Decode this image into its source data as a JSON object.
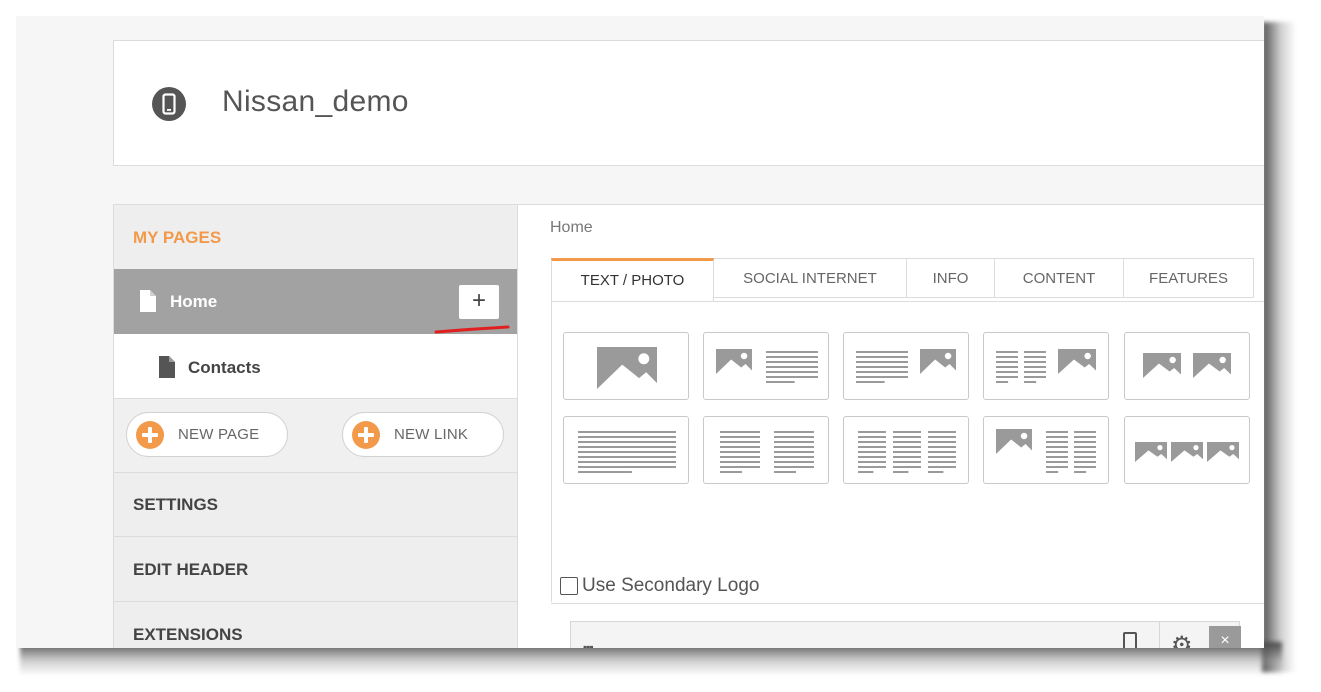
{
  "app": {
    "title": "Nissan_demo",
    "icon": "phone-icon"
  },
  "sidebar": {
    "my_pages_label": "MY PAGES",
    "pages": [
      {
        "label": "Home",
        "selected": true,
        "add_label": "+"
      },
      {
        "label": "Contacts",
        "selected": false
      }
    ],
    "new_page_label": "NEW PAGE",
    "new_link_label": "NEW LINK",
    "settings_label": "SETTINGS",
    "edit_header_label": "EDIT HEADER",
    "extensions_label": "EXTENSIONS"
  },
  "main": {
    "breadcrumb": "Home",
    "tabs": [
      {
        "label": "TEXT / PHOTO",
        "active": true
      },
      {
        "label": "SOCIAL INTERNET",
        "active": false
      },
      {
        "label": "INFO",
        "active": false
      },
      {
        "label": "CONTENT",
        "active": false
      },
      {
        "label": "FEATURES",
        "active": false
      }
    ],
    "layouts": [
      "image-only",
      "image-text",
      "text-image",
      "two-columns-image",
      "two-images",
      "text-only",
      "two-text-columns",
      "three-text-columns",
      "image-two-columns",
      "three-images"
    ],
    "secondary_logo_label": "Use Secondary Logo",
    "secondary_logo_checked": false,
    "module": {
      "grip_icon": "grip-icon",
      "device_icon": "phone-icon",
      "settings_icon": "gear-icon",
      "close_label": "×"
    }
  },
  "colors": {
    "accent": "#f2994a",
    "selected_row": "#a2a2a2",
    "annotation": "#e02020"
  }
}
